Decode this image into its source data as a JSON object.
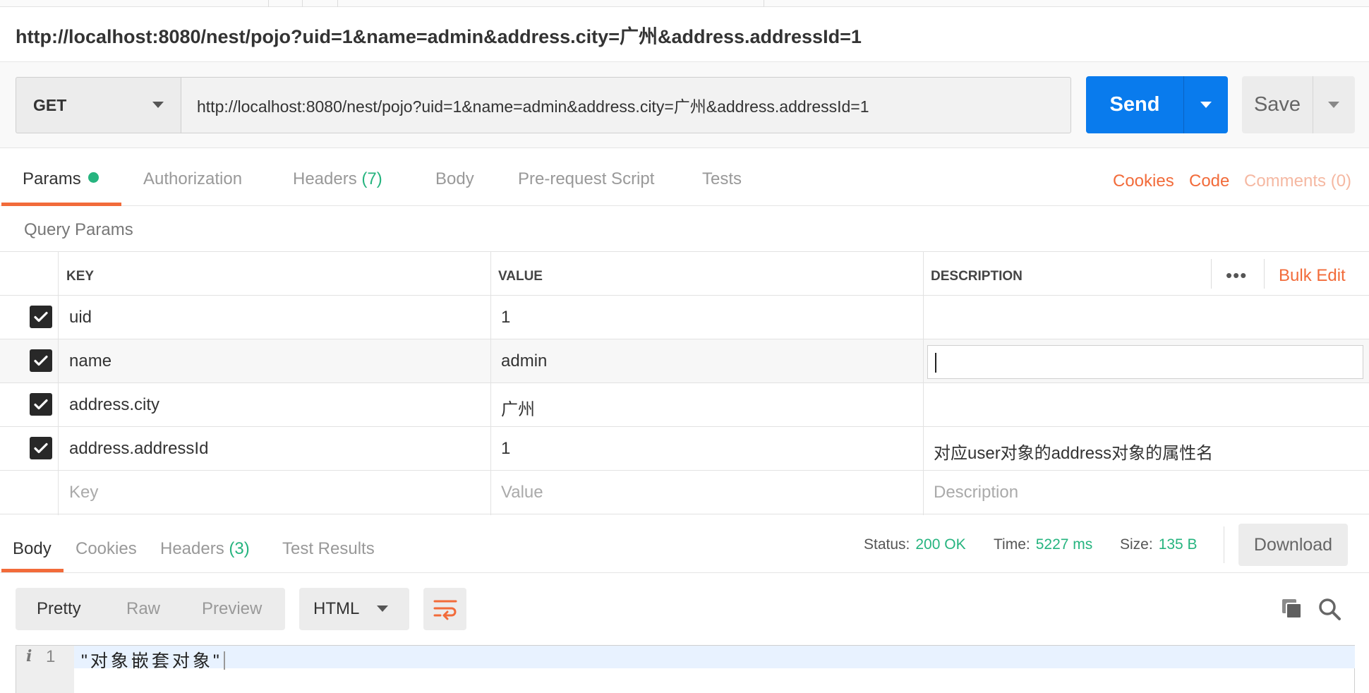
{
  "title_url": "http://localhost:8080/nest/pojo?uid=1&name=admin&address.city=广州&address.addressId=1",
  "request": {
    "method": "GET",
    "url": "http://localhost:8080/nest/pojo?uid=1&name=admin&address.city=广州&address.addressId=1",
    "send_label": "Send",
    "save_label": "Save"
  },
  "request_tabs": {
    "params": "Params",
    "authorization": "Authorization",
    "headers": "Headers",
    "headers_count": "(7)",
    "body": "Body",
    "prerequest": "Pre-request Script",
    "tests": "Tests",
    "cookies": "Cookies",
    "code": "Code",
    "comments": "Comments (0)"
  },
  "query_params": {
    "label": "Query Params",
    "columns": {
      "key": "KEY",
      "value": "VALUE",
      "description": "DESCRIPTION"
    },
    "bulk_edit": "Bulk Edit",
    "more": "•••",
    "rows": [
      {
        "key": "uid",
        "value": "1",
        "description": ""
      },
      {
        "key": "name",
        "value": "admin",
        "description": ""
      },
      {
        "key": "address.city",
        "value": "广州",
        "description": ""
      },
      {
        "key": "address.addressId",
        "value": "1",
        "description": "对应user对象的address对象的属性名"
      }
    ],
    "placeholders": {
      "key": "Key",
      "value": "Value",
      "description": "Description"
    }
  },
  "response": {
    "tabs": {
      "body": "Body",
      "cookies": "Cookies",
      "headers": "Headers",
      "headers_count": "(3)",
      "test_results": "Test Results"
    },
    "status_label": "Status:",
    "status_value": "200 OK",
    "time_label": "Time:",
    "time_value": "5227 ms",
    "size_label": "Size:",
    "size_value": "135 B",
    "download_label": "Download",
    "formats": {
      "pretty": "Pretty",
      "raw": "Raw",
      "preview": "Preview"
    },
    "language": "HTML",
    "line_number": "1",
    "info_glyph": "i",
    "code_line": "\"对象嵌套对象\""
  },
  "colors": {
    "accent_orange": "#f26b3a",
    "send_blue": "#097bed",
    "status_green": "#26b47f"
  }
}
